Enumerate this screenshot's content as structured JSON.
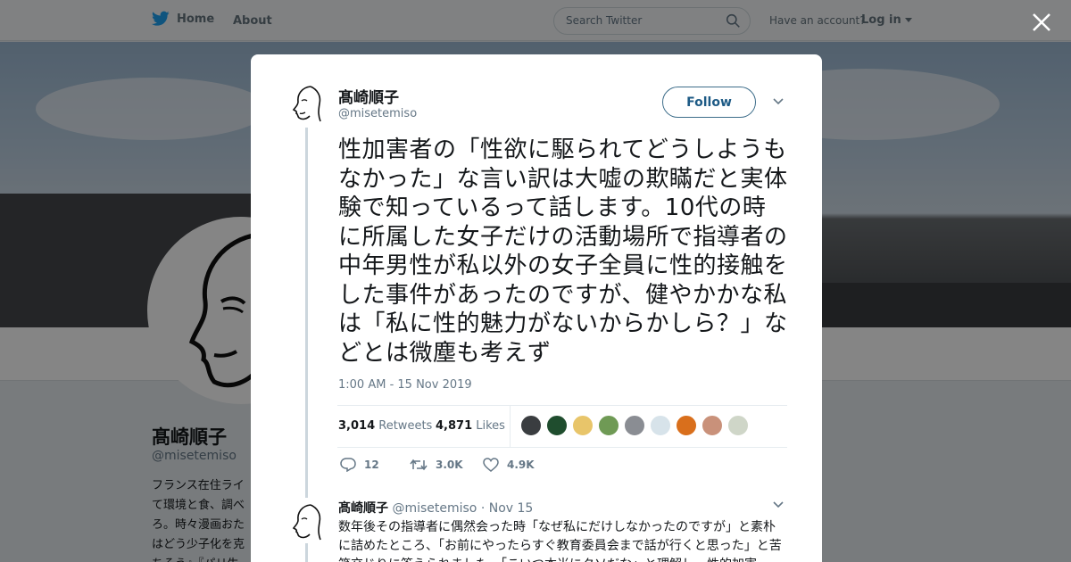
{
  "nav": {
    "home_label": "Home",
    "about_label": "About",
    "search_placeholder": "Search Twitter",
    "account_prompt": "Have an account?",
    "login_label": "Log in"
  },
  "background_profile": {
    "name": "髙崎順子",
    "handle": "@misetemiso",
    "bio": "フランス在住ライ\nて環境と食、調べ\nろ。時々漫画おた\nはどう少子化を克\nちそう』『パリ生"
  },
  "tweet": {
    "author_name": "髙崎順子",
    "author_handle": "@misetemiso",
    "follow_label": "Follow",
    "text": "性加害者の「性欲に駆られてどうしようもなかった」な言い訳は大嘘の欺瞞だと実体験で知っているって話します。10代の時に所属した女子だけの活動場所で指導者の中年男性が私以外の女子全員に性的接触をした事件があったのですが、健やかかな私は「私に性的魅力がないからかしら？」などとは微塵も考えず",
    "timestamp": "1:00 AM - 15 Nov 2019",
    "retweets_count": "3,014",
    "retweets_label": "Retweets",
    "likes_count": "4,871",
    "likes_label": "Likes",
    "reply_count": "12",
    "retweet_action_count": "3.0K",
    "like_action_count": "4.9K",
    "liker_avatar_colors": [
      "#3a3d40",
      "#1f4d2e",
      "#e8c56a",
      "#6f9a55",
      "#8a8d93",
      "#d7e3ea",
      "#d96f1c",
      "#c9917a",
      "#cfd6c8"
    ]
  },
  "reply": {
    "author_name": "髙崎順子",
    "author_handle": "@misetemiso",
    "separator": "·",
    "date": "Nov 15",
    "text": "数年後その指導者に偶然会った時「なぜ私にだけしなかったのですが」と素朴に詰めたところ、「お前にやったらすぐ教育委員会まで話が行くと思った」と苦笑交じりに答えられました。「こいつ本当にクソだな」と理解し、性的加害"
  },
  "colors": {
    "accent": "#1da1f2",
    "follow_text": "#1d5a85",
    "muted_text": "#657786",
    "thread_line": "#ccd6dd"
  },
  "icons": [
    "twitter-bird-icon",
    "search-icon",
    "caret-down-icon",
    "close-icon",
    "chevron-down-icon",
    "reply-icon",
    "retweet-icon",
    "like-icon"
  ]
}
